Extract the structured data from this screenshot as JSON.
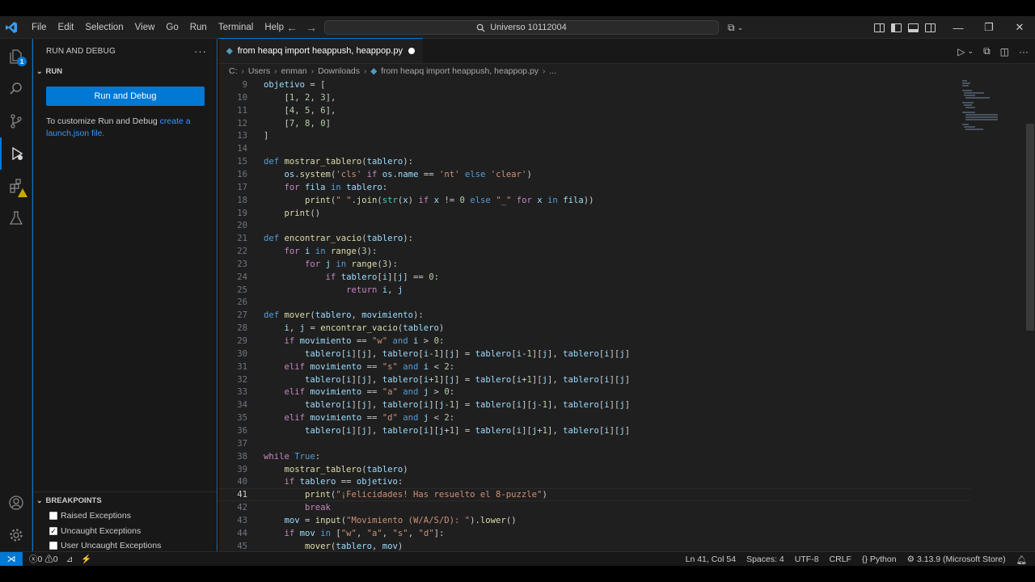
{
  "titlebar": {
    "menu": [
      "File",
      "Edit",
      "Selection",
      "View",
      "Go",
      "Run",
      "Terminal",
      "Help"
    ],
    "search_text": "Universo 10112004"
  },
  "sidebar": {
    "title": "RUN AND DEBUG",
    "section": "RUN",
    "run_button": "Run and Debug",
    "customize_text": "To customize Run and Debug",
    "customize_link": "create a launch.json file.",
    "breakpoints_title": "BREAKPOINTS",
    "breakpoints": [
      {
        "label": "Raised Exceptions",
        "checked": false
      },
      {
        "label": "Uncaught Exceptions",
        "checked": true
      },
      {
        "label": "User Uncaught Exceptions",
        "checked": false
      }
    ]
  },
  "editor": {
    "tab_title": "from heapq import heappush, heappop.py",
    "breadcrumb": [
      "C:",
      "Users",
      "enman",
      "Downloads",
      "from heapq import heappush, heappop.py",
      "..."
    ],
    "current_line": 41,
    "lines": [
      {
        "n": 9,
        "code": "objetivo = ["
      },
      {
        "n": 10,
        "code": "    [1, 2, 3],"
      },
      {
        "n": 11,
        "code": "    [4, 5, 6],"
      },
      {
        "n": 12,
        "code": "    [7, 8, 0]"
      },
      {
        "n": 13,
        "code": "]"
      },
      {
        "n": 14,
        "code": ""
      },
      {
        "n": 15,
        "code": "def mostrar_tablero(tablero):"
      },
      {
        "n": 16,
        "code": "    os.system('cls' if os.name == 'nt' else 'clear')"
      },
      {
        "n": 17,
        "code": "    for fila in tablero:"
      },
      {
        "n": 18,
        "code": "        print(\" \".join(str(x) if x != 0 else \"_\" for x in fila))"
      },
      {
        "n": 19,
        "code": "    print()"
      },
      {
        "n": 20,
        "code": ""
      },
      {
        "n": 21,
        "code": "def encontrar_vacio(tablero):"
      },
      {
        "n": 22,
        "code": "    for i in range(3):"
      },
      {
        "n": 23,
        "code": "        for j in range(3):"
      },
      {
        "n": 24,
        "code": "            if tablero[i][j] == 0:"
      },
      {
        "n": 25,
        "code": "                return i, j"
      },
      {
        "n": 26,
        "code": ""
      },
      {
        "n": 27,
        "code": "def mover(tablero, movimiento):"
      },
      {
        "n": 28,
        "code": "    i, j = encontrar_vacio(tablero)"
      },
      {
        "n": 29,
        "code": "    if movimiento == \"w\" and i > 0:"
      },
      {
        "n": 30,
        "code": "        tablero[i][j], tablero[i-1][j] = tablero[i-1][j], tablero[i][j]"
      },
      {
        "n": 31,
        "code": "    elif movimiento == \"s\" and i < 2:"
      },
      {
        "n": 32,
        "code": "        tablero[i][j], tablero[i+1][j] = tablero[i+1][j], tablero[i][j]"
      },
      {
        "n": 33,
        "code": "    elif movimiento == \"a\" and j > 0:"
      },
      {
        "n": 34,
        "code": "        tablero[i][j], tablero[i][j-1] = tablero[i][j-1], tablero[i][j]"
      },
      {
        "n": 35,
        "code": "    elif movimiento == \"d\" and j < 2:"
      },
      {
        "n": 36,
        "code": "        tablero[i][j], tablero[i][j+1] = tablero[i][j+1], tablero[i][j]"
      },
      {
        "n": 37,
        "code": ""
      },
      {
        "n": 38,
        "code": "while True:"
      },
      {
        "n": 39,
        "code": "    mostrar_tablero(tablero)"
      },
      {
        "n": 40,
        "code": "    if tablero == objetivo:"
      },
      {
        "n": 41,
        "code": "        print(\"¡Felicidades! Has resuelto el 8-puzzle\")"
      },
      {
        "n": 42,
        "code": "        break"
      },
      {
        "n": 43,
        "code": "    mov = input(\"Movimiento (W/A/S/D): \").lower()"
      },
      {
        "n": 44,
        "code": "    if mov in [\"w\", \"a\", \"s\", \"d\"]:"
      },
      {
        "n": 45,
        "code": "        mover(tablero, mov)"
      }
    ]
  },
  "statusbar": {
    "errors": "0",
    "warnings": "0",
    "position": "Ln 41, Col 54",
    "spaces": "Spaces: 4",
    "encoding": "UTF-8",
    "eol": "CRLF",
    "language": "Python",
    "interpreter": "3.13.9 (Microsoft Store)"
  },
  "colors": {
    "accent": "#0078d4",
    "editor_bg": "#1f1f1f",
    "sidebar_bg": "#181818"
  }
}
